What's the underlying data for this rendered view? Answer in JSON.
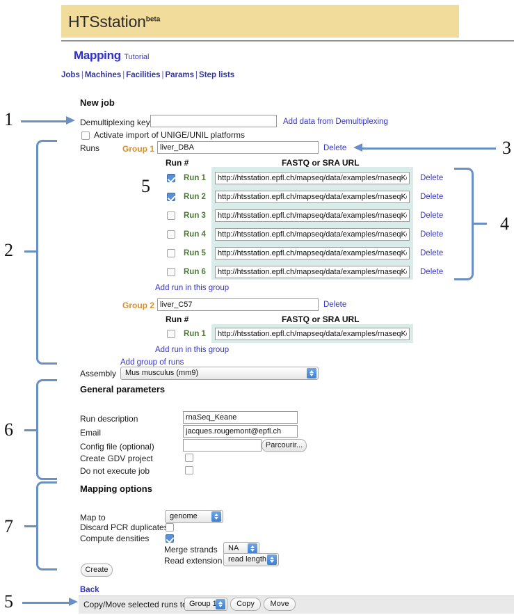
{
  "header": {
    "brand": "HTSstation",
    "brand_sup": "beta",
    "banner_color": "#f2dc9b"
  },
  "section": {
    "title": "Mapping",
    "tutorial": "Tutorial"
  },
  "nav": {
    "items": [
      "Jobs",
      "Machines",
      "Facilities",
      "Params",
      "Step lists"
    ],
    "separator": "|"
  },
  "form": {
    "new_job_heading": "New job",
    "demux_label": "Demultiplexing key",
    "demux_value": "",
    "demux_link": "Add data from Demultiplexing",
    "activate_import_label": "Activate import of UNIGE/UNIL platforms",
    "activate_import_checked": false,
    "runs_label": "Runs",
    "col_run": "Run #",
    "col_url": "FASTQ or SRA URL",
    "delete_label": "Delete",
    "add_run_link": "Add run in this group",
    "add_group_link": "Add group of runs",
    "assembly_label": "Assembly",
    "assembly_value": "Mus musculus (mm9)"
  },
  "groups": [
    {
      "group_label": "Group 1",
      "name_value": "liver_DBA",
      "runs": [
        {
          "label": "Run 1",
          "checked": true,
          "url": "http://htsstation.epfl.ch/mapseq/data/examples/rnaseqKeane/El"
        },
        {
          "label": "Run 2",
          "checked": true,
          "url": "http://htsstation.epfl.ch/mapseq/data/examples/rnaseqKeane/El"
        },
        {
          "label": "Run 3",
          "checked": false,
          "url": "http://htsstation.epfl.ch/mapseq/data/examples/rnaseqKeane/El"
        },
        {
          "label": "Run 4",
          "checked": false,
          "url": "http://htsstation.epfl.ch/mapseq/data/examples/rnaseqKeane/El"
        },
        {
          "label": "Run 5",
          "checked": false,
          "url": "http://htsstation.epfl.ch/mapseq/data/examples/rnaseqKeane/El"
        },
        {
          "label": "Run 6",
          "checked": false,
          "url": "http://htsstation.epfl.ch/mapseq/data/examples/rnaseqKeane/El"
        }
      ]
    },
    {
      "group_label": "Group 2",
      "name_value": "liver_C57",
      "runs": [
        {
          "label": "Run 1",
          "checked": false,
          "url": "http://htsstation.epfl.ch/mapseq/data/examples/rnaseqKeane/Sl"
        }
      ]
    }
  ],
  "general": {
    "heading": "General parameters",
    "run_description_label": "Run description",
    "run_description_value": "rnaSeq_Keane",
    "email_label": "Email",
    "email_value": "jacques.rougemont@epfl.ch",
    "config_label": "Config file (optional)",
    "config_value": "",
    "config_button": "Parcourir...",
    "gdv_label": "Create GDV project",
    "gdv_checked": false,
    "noexec_label": "Do not execute job",
    "noexec_checked": false
  },
  "mapping": {
    "heading": "Mapping options",
    "map_to_label": "Map to",
    "map_to_value": "genome",
    "discard_label": "Discard PCR duplicates",
    "discard_checked": false,
    "densities_label": "Compute densities",
    "densities_checked": true,
    "merge_label": "Merge strands",
    "merge_value": "NA",
    "readext_label": "Read extension",
    "readext_value": "read length",
    "create_button": "Create"
  },
  "footer": {
    "back_link": "Back",
    "copymove_label": "Copy/Move selected runs to",
    "copymove_group": "Group 1",
    "copy_button": "Copy",
    "move_button": "Move"
  },
  "annotations": {
    "n1": "1",
    "n2": "2",
    "n3": "3",
    "n4": "4",
    "n5a": "5",
    "n5b": "5",
    "n6": "6",
    "n7": "7"
  }
}
